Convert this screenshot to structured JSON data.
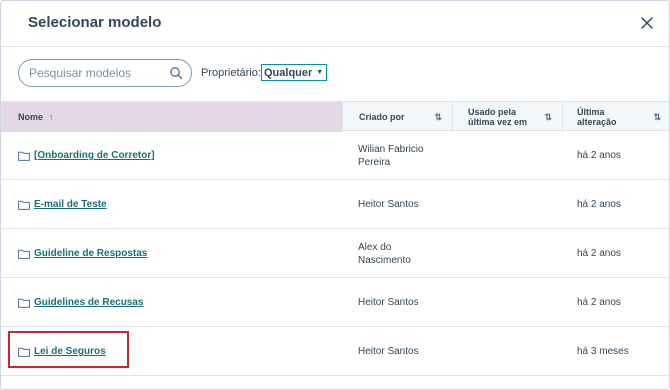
{
  "header": {
    "title": "Selecionar modelo",
    "close_icon": "close-icon"
  },
  "toolbar": {
    "search": {
      "placeholder": "Pesquisar modelos",
      "value": ""
    },
    "owner_label": "Proprietário:",
    "owner_value": "Qualquer"
  },
  "table": {
    "columns": {
      "name": "Nome",
      "created": "Criado por",
      "used": "Usado pela última vez em",
      "altered": "Última alteração"
    },
    "rows": [
      {
        "name": "[Onboarding de Corretor]",
        "created_by": "Wilian Fabricio Pereira",
        "last_used": "",
        "last_altered": "há 2 anos"
      },
      {
        "name": "E-mail de Teste",
        "created_by": "Heitor Santos",
        "last_used": "",
        "last_altered": "há 2 anos"
      },
      {
        "name": "Guideline de Respostas",
        "created_by": "Alex do Nascimento",
        "last_used": "",
        "last_altered": "há 2 anos"
      },
      {
        "name": "Guidelines de Recusas",
        "created_by": "Heitor Santos",
        "last_used": "",
        "last_altered": "há 2 anos"
      },
      {
        "name": "Lei de Seguros",
        "created_by": "Heitor Santos",
        "last_used": "",
        "last_altered": "há 3 meses"
      }
    ]
  },
  "colors": {
    "accent": "#0091ae",
    "link": "#1b6f7a",
    "highlight": "#d0252d",
    "sorted_header": "#e5d8e6"
  }
}
